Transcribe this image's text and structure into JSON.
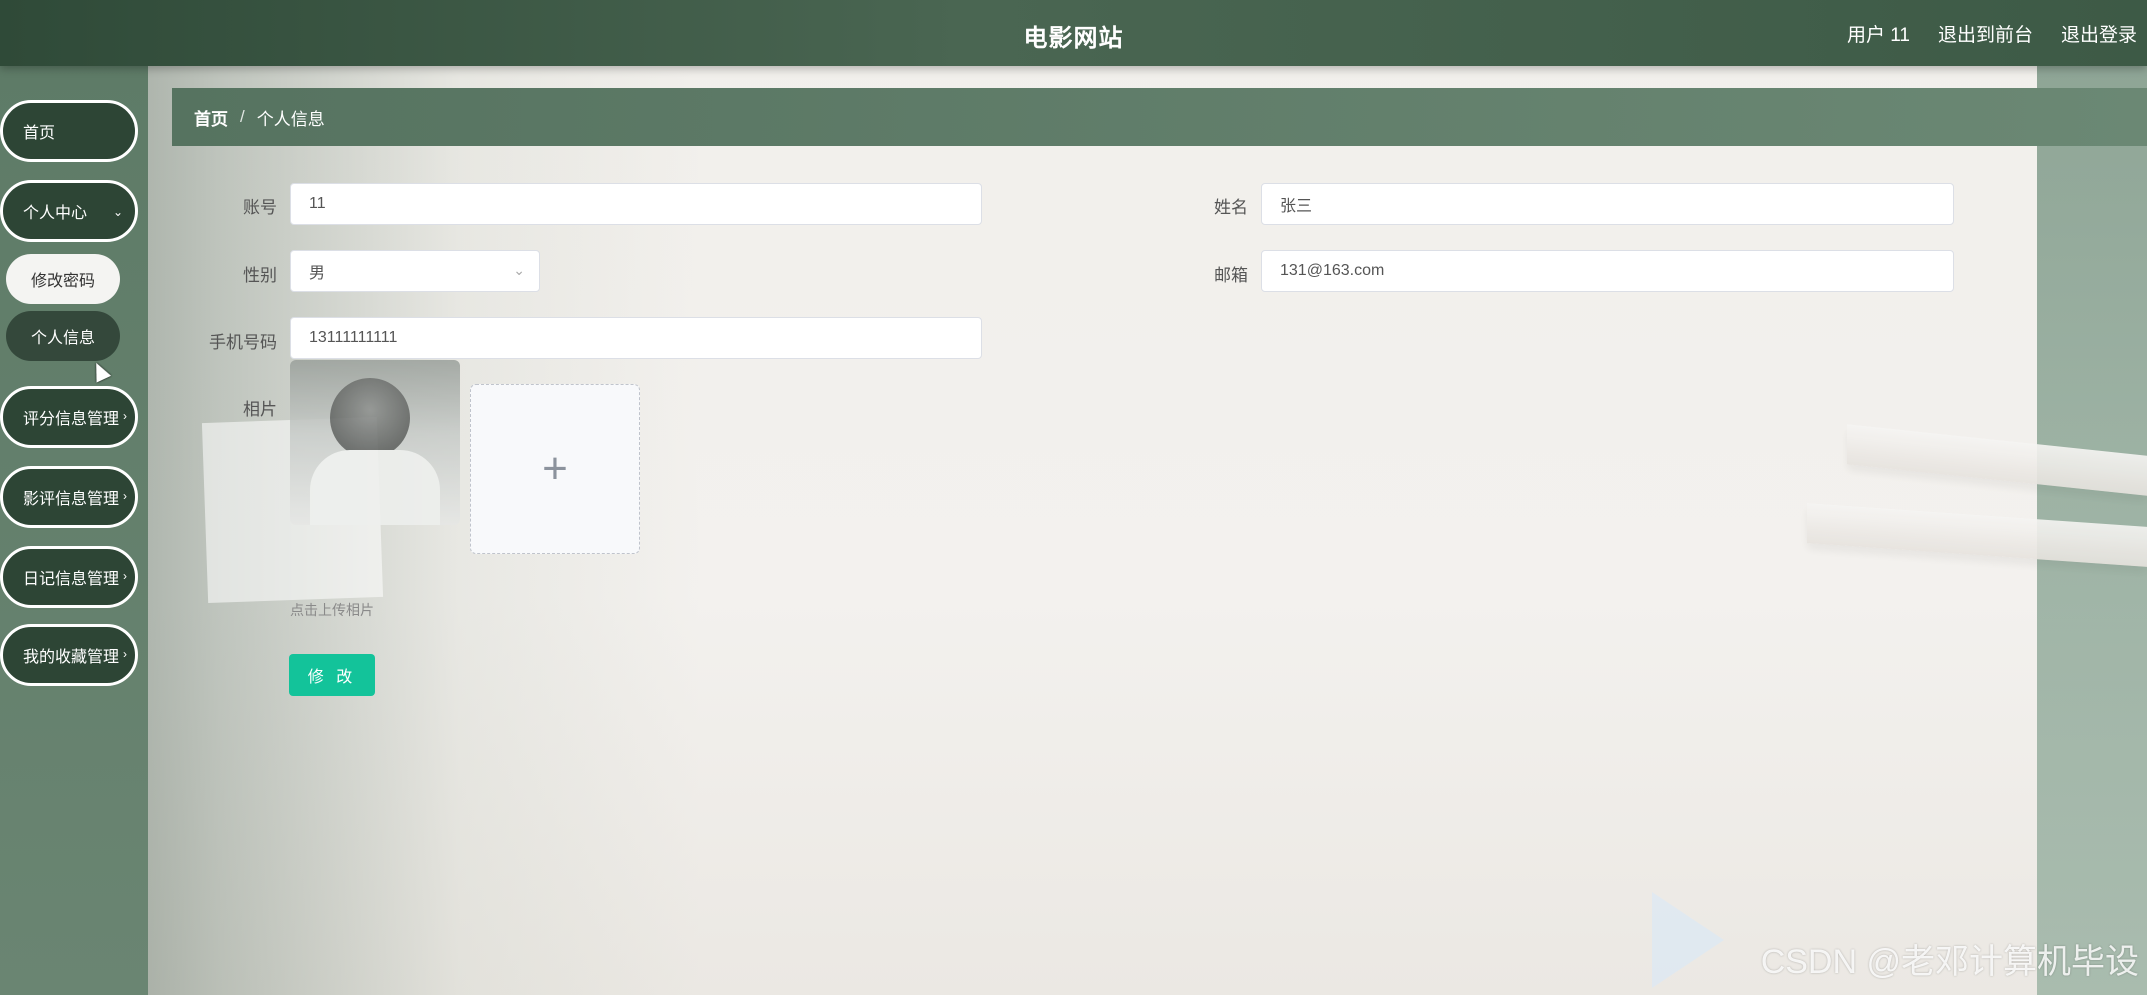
{
  "header": {
    "title": "电影网站",
    "links": [
      "用户 11",
      "退出到前台",
      "退出登录"
    ]
  },
  "sidebar": {
    "items": [
      {
        "label": "首页"
      },
      {
        "label": "个人中心",
        "expanded": true
      },
      {
        "label": "评分信息管理"
      },
      {
        "label": "影评信息管理"
      },
      {
        "label": "日记信息管理"
      },
      {
        "label": "我的收藏管理"
      }
    ],
    "sub_items": [
      {
        "label": "修改密码"
      },
      {
        "label": "个人信息",
        "active": true
      }
    ]
  },
  "breadcrumb": {
    "home": "首页",
    "separator": "/",
    "current": "个人信息"
  },
  "form": {
    "account_label": "账号",
    "account_value": "11",
    "name_label": "姓名",
    "name_value": "张三",
    "gender_label": "性别",
    "gender_value": "男",
    "email_label": "邮箱",
    "email_value": "131@163.com",
    "phone_label": "手机号码",
    "phone_value": "13111111111",
    "photo_label": "相片",
    "upload_tip": "点击上传相片",
    "submit_label": "修 改"
  },
  "watermark": "CSDN @老邓计算机毕设",
  "colors": {
    "header": "#3d5a46",
    "sidebar_pill": "#2d4535",
    "breadcrumb": "#567360",
    "submit": "#13c39a"
  }
}
